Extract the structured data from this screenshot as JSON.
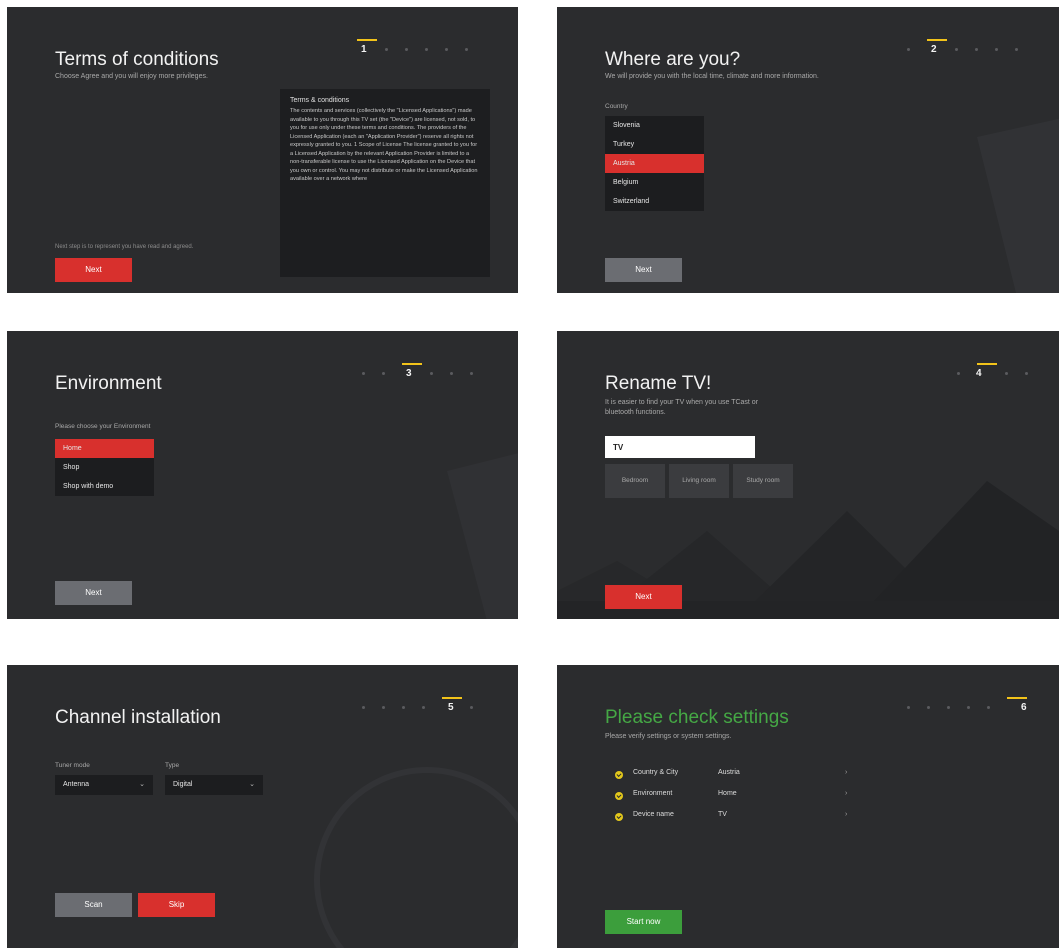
{
  "screens": {
    "terms": {
      "title": "Terms of conditions",
      "subtitle": "Choose Agree and you will enjoy more privileges.",
      "step": "1",
      "box_title": "Terms & conditions",
      "box_text": "The contents and services (collectively the \"Licensed Applications\") made available to you through this TV set (the \"Device\") are licensed, not sold, to you for use only under these terms and conditions. The providers of the Licensed Application (each an \"Application Provider\") reserve all rights not expressly granted to you. 1 Scope of License The license granted to you for a Licensed Application by the relevant Application Provider is limited to a non-transferable license to use the Licensed Application on the Device that you own or control. You may not distribute or make the Licensed Application available over a network where",
      "footnote": "Next step is to represent you have read and agreed.",
      "next_label": "Next"
    },
    "where": {
      "title": "Where are you?",
      "subtitle": "We will provide you with the local time, climate and more information.",
      "step": "2",
      "country_label": "Country",
      "countries": [
        "Slovenia",
        "Turkey",
        "Austria",
        "Belgium",
        "Switzerland"
      ],
      "selected_country": "Austria",
      "next_label": "Next"
    },
    "environment": {
      "title": "Environment",
      "step": "3",
      "prompt": "Please choose your Environment",
      "options": [
        "Home",
        "Shop",
        "Shop with demo"
      ],
      "selected": "Home",
      "next_label": "Next"
    },
    "rename": {
      "title": "Rename TV!",
      "subtitle_line1": "It is easier to find your TV when you use TCast or",
      "subtitle_line2": "bluetooth functions.",
      "step": "4",
      "input_value": "TV",
      "presets": [
        "Bedroom",
        "Living room",
        "Study room"
      ],
      "next_label": "Next"
    },
    "channel": {
      "title": "Channel installation",
      "step": "5",
      "tuner_label": "Tuner mode",
      "tuner_value": "Antenna",
      "type_label": "Type",
      "type_value": "Digital",
      "scan_label": "Scan",
      "skip_label": "Skip"
    },
    "check": {
      "title": "Please check settings",
      "subtitle": "Please verify settings or system settings.",
      "step": "6",
      "rows": [
        {
          "key": "Country & City",
          "value": "Austria"
        },
        {
          "key": "Environment",
          "value": "Home"
        },
        {
          "key": "Device name",
          "value": "TV"
        }
      ],
      "start_label": "Start now"
    }
  },
  "colors": {
    "screen_bg": "#2b2c2e",
    "accent_red": "#d8302d",
    "accent_green": "#3c9e3c",
    "step_yellow": "#f2c31a"
  },
  "icons": [
    "check-circle-icon",
    "chevron-down-icon",
    "chevron-right-icon"
  ]
}
